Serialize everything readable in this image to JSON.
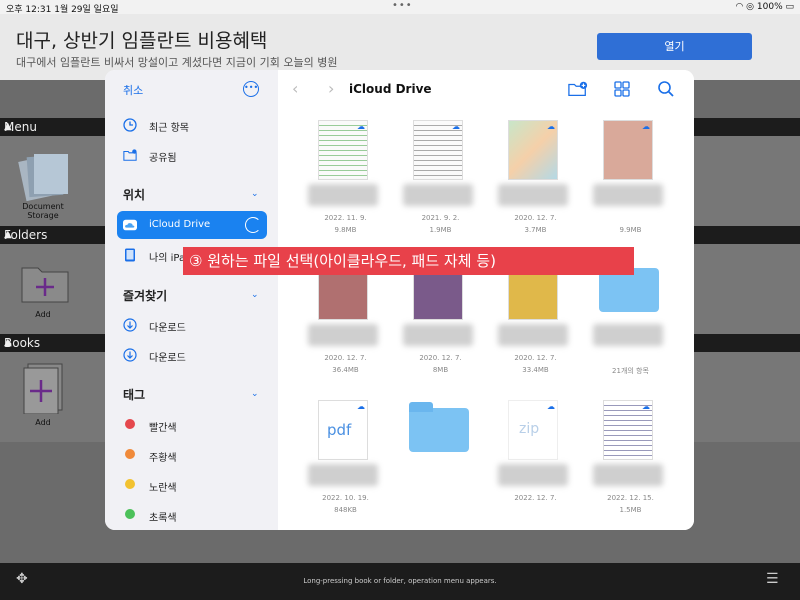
{
  "statusbar": {
    "time": "오후 12:31  1월 29일 일요일",
    "dots": "•••",
    "battery": "100%"
  },
  "ad": {
    "title": "대구, 상반기 임플란트 비용혜택",
    "desc": "대구에서 임플란트 비싸서 망설이고 계셨다면 지금이 기회 오늘의 병원",
    "button": "열기"
  },
  "background": {
    "menu_band": "Menu",
    "folders_band": "Folders",
    "books_band": "Books",
    "document_storage": "Document\nStorage",
    "add_label_1": "Add",
    "add_label_2": "Add",
    "bottom_hint": "Long-pressing book or folder, operation menu appears."
  },
  "sidebar": {
    "cancel": "취소",
    "recent": "최근 항목",
    "shared": "공유됨",
    "locations_header": "위치",
    "icloud": "iCloud Drive",
    "my_ipad": "나의 iPad",
    "favorites_header": "즐겨찾기",
    "downloads_1": "다운로드",
    "downloads_2": "다운로드",
    "tags_header": "태그",
    "tags": [
      {
        "label": "빨간색",
        "color": "#e5484d"
      },
      {
        "label": "주황색",
        "color": "#f08a3a"
      },
      {
        "label": "노란색",
        "color": "#f2c230"
      },
      {
        "label": "초록색",
        "color": "#4cc15a"
      }
    ]
  },
  "main": {
    "title": "iCloud Drive",
    "files": [
      {
        "date": "2022. 11. 9.",
        "size": "9.8MB"
      },
      {
        "date": "2021. 9. 2.",
        "size": "1.9MB"
      },
      {
        "date": "2020. 12. 7.",
        "size": "3.7MB"
      },
      {
        "date": "",
        "size": "9.9MB"
      },
      {
        "date": "2020. 12. 7.",
        "size": "36.4MB"
      },
      {
        "date": "2020. 12. 7.",
        "size": "8MB"
      },
      {
        "date": "2020. 12. 7.",
        "size": "33.4MB"
      },
      {
        "date": "",
        "size": "21개의 항목"
      },
      {
        "date": "2022. 10. 19.",
        "size": "848KB",
        "label": "pdf"
      },
      {
        "date": "",
        "size": ""
      },
      {
        "date": "2022. 12. 7.",
        "size": "",
        "label": "zip"
      },
      {
        "date": "2022. 12. 15.",
        "size": "1.5MB"
      }
    ]
  },
  "annotation": {
    "text": "③ 원하는 파일 선택(아이클라우드, 패드 자체 등)"
  }
}
